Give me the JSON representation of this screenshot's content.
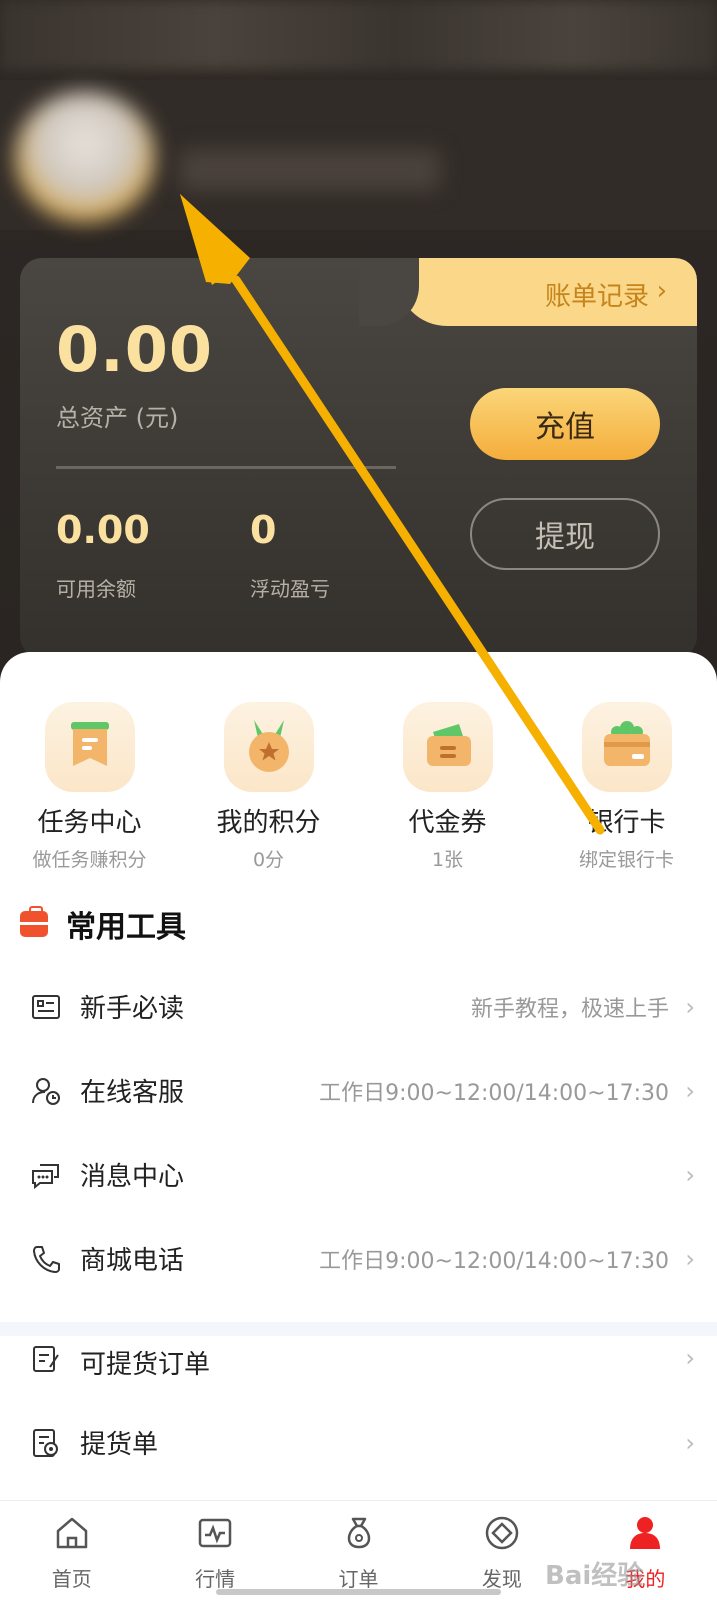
{
  "card": {
    "bill_label": "账单记录",
    "bill_chevron": "›",
    "total_assets": "0.00",
    "total_assets_label": "总资产 (元)",
    "recharge_label": "充值",
    "withdraw_label": "提现",
    "available_value": "0.00",
    "available_label": "可用余额",
    "floating_value": "0",
    "floating_label": "浮动盈亏"
  },
  "quick_actions": [
    {
      "name": "任务中心",
      "sub": "做任务赚积分",
      "icon": "task-center-icon"
    },
    {
      "name": "我的积分",
      "sub": "0分",
      "icon": "points-medal-icon"
    },
    {
      "name": "代金券",
      "sub": "1张",
      "icon": "voucher-wallet-icon"
    },
    {
      "name": "银行卡",
      "sub": "绑定银行卡",
      "icon": "bank-card-icon"
    }
  ],
  "tools": {
    "title": "常用工具",
    "items": [
      {
        "label": "新手必读",
        "hint": "新手教程，极速上手",
        "icon": "guide-doc-icon"
      },
      {
        "label": "在线客服",
        "hint": "工作日9:00~12:00/14:00~17:30",
        "icon": "customer-service-icon"
      },
      {
        "label": "消息中心",
        "hint": "",
        "icon": "message-icon"
      },
      {
        "label": "商城电话",
        "hint": "工作日9:00~12:00/14:00~17:30",
        "icon": "phone-icon"
      }
    ]
  },
  "orders": {
    "items": [
      {
        "label": "可提货订单",
        "icon": "pickup-order-icon"
      },
      {
        "label": "提货单",
        "icon": "pickup-slip-icon"
      }
    ]
  },
  "chevron": "›",
  "nav": {
    "items": [
      {
        "label": "首页",
        "icon": "home-icon"
      },
      {
        "label": "行情",
        "icon": "market-icon"
      },
      {
        "label": "订单",
        "icon": "order-bag-icon"
      },
      {
        "label": "发现",
        "icon": "discover-icon"
      },
      {
        "label": "我的",
        "icon": "profile-icon"
      }
    ],
    "active": "我的"
  },
  "watermark": "Bai经验",
  "colors": {
    "accent_gold": "#fbe1a0",
    "button_gold": "#f4ad3b",
    "active_red": "#e22222",
    "annotation_arrow": "#f5b000"
  }
}
